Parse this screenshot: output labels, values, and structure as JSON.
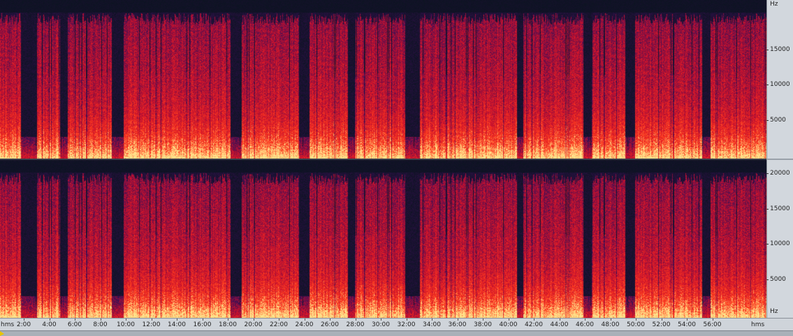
{
  "frequency_axis": {
    "unit": "Hz",
    "top_labels": [
      "15000",
      "10000",
      "5000"
    ],
    "bottom_labels": [
      "20000",
      "15000",
      "10000",
      "5000"
    ]
  },
  "time_axis": {
    "unit_left": "hms",
    "unit_right": "hms",
    "labels": [
      "2:00",
      "4:00",
      "6:00",
      "8:00",
      "10:00",
      "12:00",
      "14:00",
      "16:00",
      "18:00",
      "20:00",
      "22:00",
      "24:00",
      "26:00",
      "28:00",
      "30:00",
      "32:00",
      "34:00",
      "36:00",
      "38:00",
      "40:00",
      "42:00",
      "44:00",
      "46:00",
      "48:00",
      "50:00",
      "52:00",
      "54:00",
      "56:00"
    ]
  },
  "colors": {
    "background": "#0d1322",
    "low": "#3a0f55",
    "mid": "#c8102e",
    "high": "#ff3c1e",
    "peak": "#ffe28a"
  }
}
